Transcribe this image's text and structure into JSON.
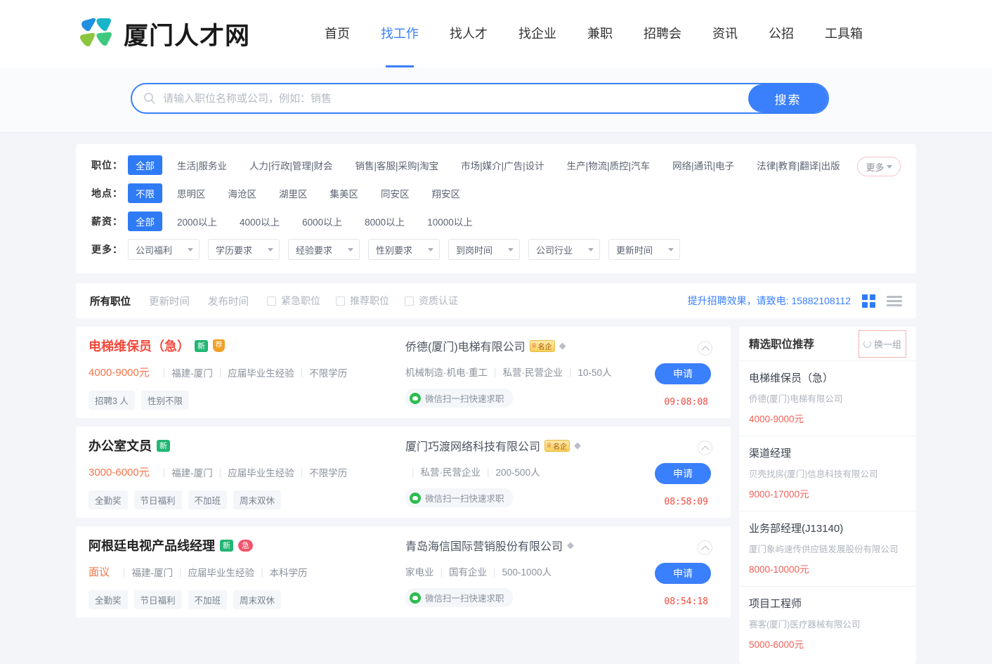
{
  "header": {
    "logo_text": "厦门人才网",
    "logo_icon": "four-diamond-logo-icon",
    "nav": [
      {
        "label": "首页",
        "active": false
      },
      {
        "label": "找工作",
        "active": true
      },
      {
        "label": "找人才",
        "active": false
      },
      {
        "label": "找企业",
        "active": false
      },
      {
        "label": "兼职",
        "active": false
      },
      {
        "label": "招聘会",
        "active": false
      },
      {
        "label": "资讯",
        "active": false
      },
      {
        "label": "公招",
        "active": false
      },
      {
        "label": "工具箱",
        "active": false
      }
    ]
  },
  "search": {
    "placeholder": "请输入职位名称或公司，例如：销售",
    "value": "",
    "button_label": "搜索",
    "icon": "search-icon"
  },
  "filters": {
    "rows": [
      {
        "label": "职位：",
        "options": [
          "全部",
          "生活|服务业",
          "人力|行政|管理|财会",
          "销售|客服|采购|淘宝",
          "市场|媒介|广告|设计",
          "生产|物流|质控|汽车",
          "网络|通讯|电子",
          "法律|教育|翻译|出版"
        ],
        "selected": "全部"
      },
      {
        "label": "地点：",
        "options": [
          "不限",
          "思明区",
          "海沧区",
          "湖里区",
          "集美区",
          "同安区",
          "翔安区"
        ],
        "selected": "不限"
      },
      {
        "label": "薪资：",
        "options": [
          "全部",
          "2000以上",
          "4000以上",
          "6000以上",
          "8000以上",
          "10000以上"
        ],
        "selected": "全部"
      }
    ],
    "more_button": "更多",
    "more_label": "更多：",
    "selects": [
      "公司福利",
      "学历要求",
      "经验要求",
      "性别要求",
      "到岗时间",
      "公司行业",
      "更新时间"
    ]
  },
  "sortbar": {
    "tabs": [
      {
        "label": "所有职位",
        "active": true
      },
      {
        "label": "更新时间",
        "active": false
      },
      {
        "label": "发布时间",
        "active": false
      }
    ],
    "checkboxes": [
      {
        "label": "紧急职位",
        "checked": false
      },
      {
        "label": "推荐职位",
        "checked": false
      },
      {
        "label": "资质认证",
        "checked": false
      }
    ],
    "promo_text": "提升招聘效果，请致电: 15882108112",
    "view_grid_icon": "grid-view-icon",
    "view_list_icon": "list-view-icon",
    "accent": "#3a7ffb"
  },
  "jobs": [
    {
      "title": "电梯维保员（急）",
      "title_urgent": true,
      "badges": [
        "新",
        "荐"
      ],
      "salary": "4000-9000元",
      "location": "福建-厦门",
      "experience": "应届毕业生经验",
      "education": "不限学历",
      "tags": [
        "招聘3 人",
        "性别不限"
      ],
      "company": "侨德(厦门)电梯有限公司",
      "company_badge": "名企",
      "company_industry": "机械制造·机电·重工",
      "company_type": "私营·民营企业",
      "company_size": "10-50人",
      "leading_sep": false,
      "wechat_text": "微信扫一扫快速求职",
      "apply_label": "申请",
      "time": "09:08:08"
    },
    {
      "title": "办公室文员",
      "title_urgent": false,
      "badges": [
        "新"
      ],
      "salary": "3000-6000元",
      "location": "福建-厦门",
      "experience": "应届毕业生经验",
      "education": "不限学历",
      "tags": [
        "全勤奖",
        "节日福利",
        "不加班",
        "周末双休"
      ],
      "company": "厦门巧渡网络科技有限公司",
      "company_badge": "名企",
      "company_industry": "",
      "company_type": "私营·民营企业",
      "company_size": "200-500人",
      "leading_sep": true,
      "wechat_text": "微信扫一扫快速求职",
      "apply_label": "申请",
      "time": "08:58:09"
    },
    {
      "title": "阿根廷电视产品线经理",
      "title_urgent": false,
      "badges": [
        "新",
        "急"
      ],
      "salary": "面议",
      "location": "福建-厦门",
      "experience": "应届毕业生经验",
      "education": "本科学历",
      "tags": [
        "全勤奖",
        "节日福利",
        "不加班",
        "周末双休"
      ],
      "company": "青岛海信国际营销股份有限公司",
      "company_badge": "",
      "company_industry": "家电业",
      "company_type": "国有企业",
      "company_size": "500-1000人",
      "leading_sep": false,
      "wechat_text": "微信扫一扫快速求职",
      "apply_label": "申请",
      "time": "08:54:18"
    }
  ],
  "sidebar": {
    "title": "精选职位推荐",
    "refresh_label": "换一组",
    "refresh_icon": "refresh-icon",
    "items": [
      {
        "title": "电梯维保员（急）",
        "company": "侨德(厦门)电梯有限公司",
        "salary": "4000-9000元"
      },
      {
        "title": "渠道经理",
        "company": "贝壳找房(厦门)信息科技有限公司",
        "salary": "9000-17000元"
      },
      {
        "title": "业务部经理(J13140)",
        "company": "厦门象屿速传供应链发展股份有限公司",
        "salary": "8000-10000元"
      },
      {
        "title": "项目工程师",
        "company": "赛客(厦门)医疗器械有限公司",
        "salary": "5000-6000元"
      }
    ]
  }
}
